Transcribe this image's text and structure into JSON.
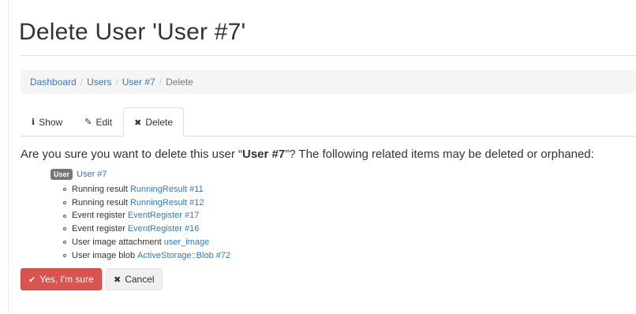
{
  "page": {
    "title": "Delete User 'User #7'"
  },
  "breadcrumb": {
    "items": [
      "Dashboard",
      "Users",
      "User #7"
    ],
    "separator": "/",
    "current": "Delete"
  },
  "tabs": [
    {
      "icon": "info-circle-icon",
      "glyph": "ℹ",
      "label": "Show"
    },
    {
      "icon": "pencil-icon",
      "glyph": "✎",
      "label": "Edit"
    },
    {
      "icon": "times-icon",
      "glyph": "✖",
      "label": "Delete",
      "active": true
    }
  ],
  "confirm": {
    "prefix": "Are you sure you want to delete this user “",
    "name": "User #7",
    "suffix": "”? The following related items may be deleted or orphaned:"
  },
  "root": {
    "badge": "User",
    "link": "User #7"
  },
  "related": [
    {
      "type": "Running result",
      "link": "RunningResult #11"
    },
    {
      "type": "Running result",
      "link": "RunningResult #12"
    },
    {
      "type": "Event register",
      "link": "EventRegister #17"
    },
    {
      "type": "Event register",
      "link": "EventRegister #16"
    },
    {
      "type": "User image attachment",
      "link": "user_image"
    },
    {
      "type": "User image blob",
      "link": "ActiveStorage::Blob #72"
    }
  ],
  "buttons": {
    "confirm_icon": "✔",
    "confirm_label": "Yes, I'm sure",
    "cancel_icon": "✖",
    "cancel_label": "Cancel"
  },
  "colors": {
    "link": "#337ab7",
    "danger": "#d9534f",
    "badge": "#777777"
  }
}
